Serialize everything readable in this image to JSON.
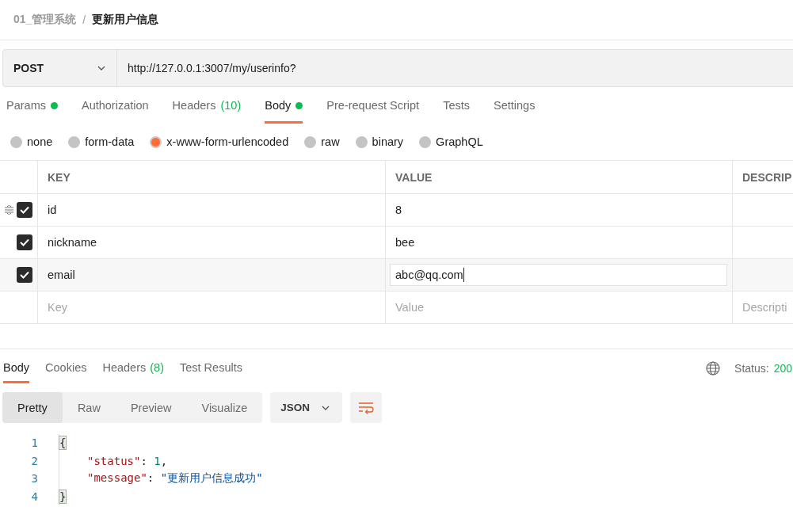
{
  "breadcrumb": {
    "collection": "01_管理系统",
    "separator": "/",
    "request": "更新用户信息"
  },
  "request": {
    "method": "POST",
    "url": "http://127.0.0.1:3007/my/userinfo?"
  },
  "request_tabs": [
    {
      "label": "Params",
      "dot": true,
      "selected": false
    },
    {
      "label": "Authorization",
      "dot": false,
      "selected": false
    },
    {
      "label": "Headers",
      "count": "(10)",
      "dot": false,
      "selected": false
    },
    {
      "label": "Body",
      "dot": true,
      "selected": true
    },
    {
      "label": "Pre-request Script",
      "dot": false,
      "selected": false
    },
    {
      "label": "Tests",
      "dot": false,
      "selected": false
    },
    {
      "label": "Settings",
      "dot": false,
      "selected": false
    }
  ],
  "body_types": [
    {
      "label": "none",
      "selected": false
    },
    {
      "label": "form-data",
      "selected": false
    },
    {
      "label": "x-www-form-urlencoded",
      "selected": true
    },
    {
      "label": "raw",
      "selected": false
    },
    {
      "label": "binary",
      "selected": false
    },
    {
      "label": "GraphQL",
      "selected": false
    }
  ],
  "table": {
    "columns": [
      "KEY",
      "VALUE",
      "DESCRIP"
    ],
    "rows": [
      {
        "key": "id",
        "value": "8",
        "checked": true,
        "focused": false
      },
      {
        "key": "nickname",
        "value": "bee",
        "checked": true,
        "focused": false
      },
      {
        "key": "email",
        "value": "abc@qq.com",
        "checked": true,
        "focused": true
      }
    ],
    "placeholders": [
      "Key",
      "Value",
      "Descripti"
    ]
  },
  "response_tabs": [
    {
      "label": "Body",
      "selected": true
    },
    {
      "label": "Cookies",
      "selected": false
    },
    {
      "label": "Headers",
      "count": "(8)",
      "selected": false
    },
    {
      "label": "Test Results",
      "selected": false
    }
  ],
  "status": {
    "label": "Status:",
    "value": "200"
  },
  "view_modes": [
    {
      "label": "Pretty",
      "selected": true
    },
    {
      "label": "Raw",
      "selected": false
    },
    {
      "label": "Preview",
      "selected": false
    },
    {
      "label": "Visualize",
      "selected": false
    }
  ],
  "format": "JSON",
  "code_lines": [
    {
      "number": "1",
      "tokens": [
        {
          "kind": "brace",
          "text": "{"
        }
      ]
    },
    {
      "number": "2",
      "tokens": [
        {
          "kind": "key",
          "text": "\"status\""
        },
        {
          "kind": "punct",
          "text": ": "
        },
        {
          "kind": "number",
          "text": "1"
        },
        {
          "kind": "punct",
          "text": ","
        }
      ]
    },
    {
      "number": "3",
      "tokens": [
        {
          "kind": "key",
          "text": "\"message\""
        },
        {
          "kind": "punct",
          "text": ": "
        },
        {
          "kind": "string",
          "text": "\"更新用户信息成功\""
        }
      ]
    },
    {
      "number": "4",
      "tokens": [
        {
          "kind": "brace",
          "text": "}"
        }
      ]
    }
  ]
}
